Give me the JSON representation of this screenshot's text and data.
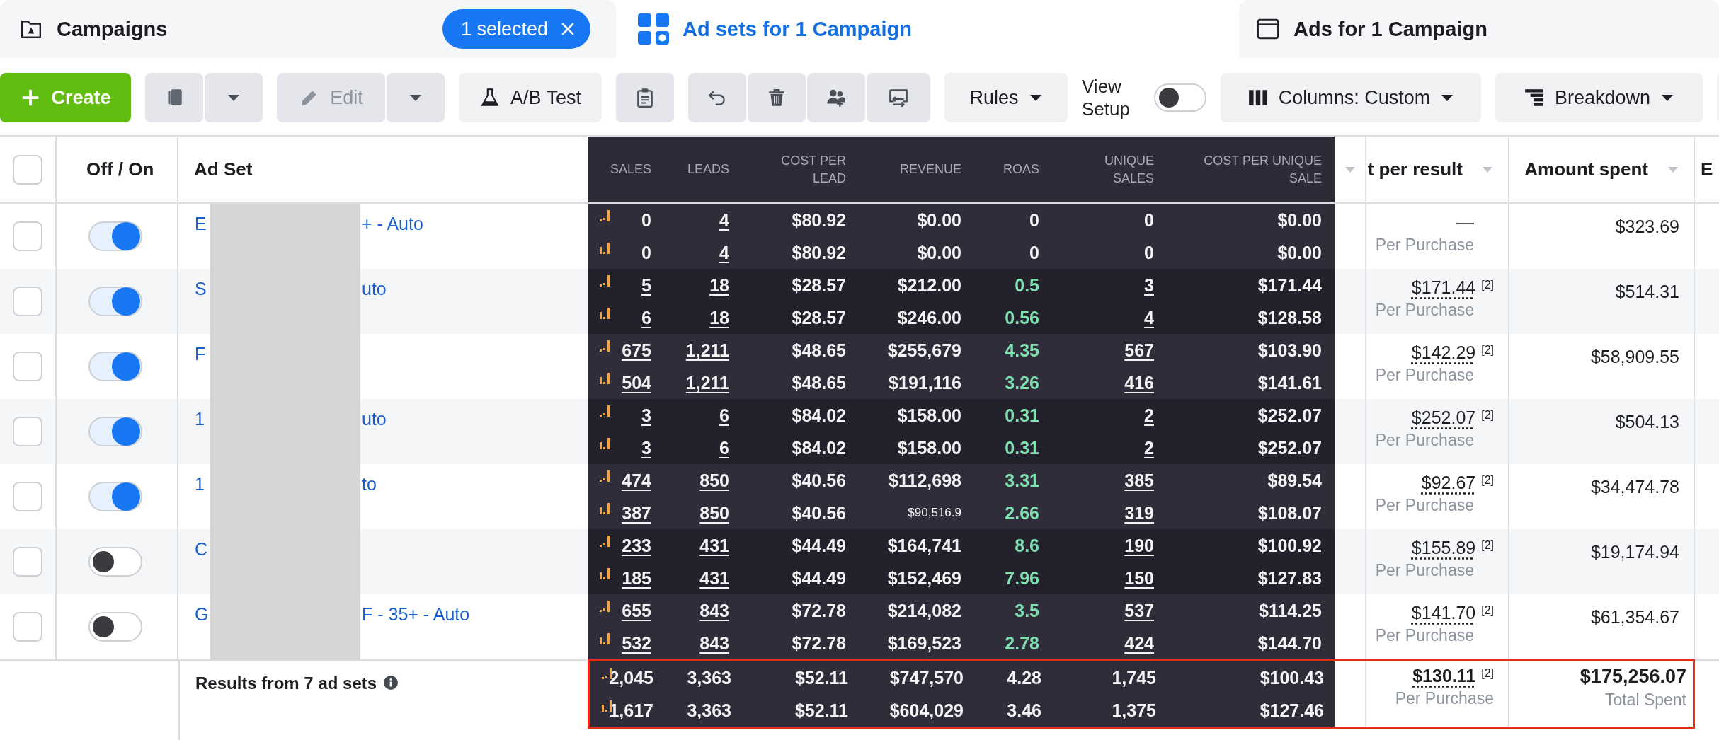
{
  "tabs": [
    {
      "kind": "campaigns",
      "label": "Campaigns",
      "selected": false,
      "badge": "1 selected"
    },
    {
      "kind": "adsets",
      "label": "Ad sets for 1 Campaign",
      "selected": true
    },
    {
      "kind": "ads",
      "label": "Ads for 1 Campaign",
      "selected": false
    }
  ],
  "toolbar": [
    {
      "kind": "group",
      "buttons": [
        {
          "kind": "create",
          "label": "Create"
        }
      ]
    },
    {
      "kind": "group",
      "buttons": [
        {
          "kind": "duplicate"
        },
        {
          "kind": "dropdown"
        }
      ]
    },
    {
      "kind": "group",
      "buttons": [
        {
          "kind": "edit",
          "label": "Edit",
          "disabled": true
        },
        {
          "kind": "dropdown"
        }
      ]
    },
    {
      "kind": "group",
      "buttons": [
        {
          "kind": "test",
          "label": "A/B Test"
        }
      ]
    },
    {
      "kind": "group",
      "buttons": [
        {
          "kind": "paste"
        }
      ]
    },
    {
      "kind": "group",
      "buttons": [
        {
          "kind": "undo"
        },
        {
          "kind": "delete"
        },
        {
          "kind": "share"
        },
        {
          "kind": "swap"
        }
      ]
    },
    {
      "kind": "group",
      "buttons": [
        {
          "kind": "rules",
          "label": "Rules"
        }
      ]
    },
    {
      "kind": "switch",
      "label": "View Setup",
      "on": false
    },
    {
      "kind": "group",
      "buttons": [
        {
          "kind": "columns",
          "label": "Columns: Custom"
        }
      ]
    },
    {
      "kind": "group",
      "buttons": [
        {
          "kind": "breakdown",
          "label": "Breakdown"
        }
      ]
    },
    {
      "kind": "group",
      "buttons": [
        {
          "kind": "blank"
        }
      ]
    }
  ],
  "table": {
    "header_checked": false,
    "columns": [
      "Off / On",
      "Ad Set"
    ],
    "metric_columns": [
      "SALES",
      "LEADS",
      "COST PER LEAD",
      "REVENUE",
      "ROAS",
      "UNIQUE SALES",
      "COST PER UNIQUE SALE"
    ],
    "right_columns": [
      "t per result",
      "Amount spent",
      "E"
    ],
    "rows": [
      {
        "checked": false,
        "on": true,
        "name_start": "E",
        "name_end": "+ - Auto",
        "lines": [
          [
            {
              "text": "0"
            },
            {
              "text": "4",
              "link": true
            },
            {
              "text": "$80.92"
            },
            {
              "text": "$0.00"
            },
            {
              "text": "0",
              "positive": false
            },
            {
              "text": "0"
            },
            {
              "text": "$0.00"
            }
          ],
          [
            {
              "text": "0"
            },
            {
              "text": "4",
              "link": true
            },
            {
              "text": "$80.92"
            },
            {
              "text": "$0.00"
            },
            {
              "text": "0",
              "positive": false
            },
            {
              "text": "0"
            },
            {
              "text": "$0.00"
            }
          ]
        ],
        "cost_per_result": "—",
        "result_label": "Per Purchase",
        "amount_spent": "$323.69"
      },
      {
        "checked": false,
        "on": true,
        "name_start": "S",
        "name_end": "uto",
        "lines": [
          [
            {
              "text": "5",
              "link": true
            },
            {
              "text": "18",
              "link": true
            },
            {
              "text": "$28.57"
            },
            {
              "text": "$212.00"
            },
            {
              "text": "0.5",
              "positive": true
            },
            {
              "text": "3",
              "link": true
            },
            {
              "text": "$171.44"
            }
          ],
          [
            {
              "text": "6",
              "link": true
            },
            {
              "text": "18",
              "link": true
            },
            {
              "text": "$28.57"
            },
            {
              "text": "$246.00"
            },
            {
              "text": "0.56",
              "positive": true
            },
            {
              "text": "4",
              "link": true
            },
            {
              "text": "$128.58"
            }
          ]
        ],
        "cost_per_result": "$171.44",
        "footnote": "[2]",
        "result_label": "Per Purchase",
        "amount_spent": "$514.31"
      },
      {
        "checked": false,
        "on": true,
        "name_start": "F",
        "lines": [
          [
            {
              "text": "675",
              "link": true
            },
            {
              "text": "1,211",
              "link": true
            },
            {
              "text": "$48.65"
            },
            {
              "text": "$255,679"
            },
            {
              "text": "4.35",
              "positive": true
            },
            {
              "text": "567",
              "link": true
            },
            {
              "text": "$103.90"
            }
          ],
          [
            {
              "text": "504",
              "link": true
            },
            {
              "text": "1,211",
              "link": true
            },
            {
              "text": "$48.65"
            },
            {
              "text": "$191,116"
            },
            {
              "text": "3.26",
              "positive": true
            },
            {
              "text": "416",
              "link": true
            },
            {
              "text": "$141.61"
            }
          ]
        ],
        "cost_per_result": "$142.29",
        "footnote": "[2]",
        "result_label": "Per Purchase",
        "amount_spent": "$58,909.55"
      },
      {
        "checked": false,
        "on": true,
        "name_start": "1",
        "name_end": "uto",
        "lines": [
          [
            {
              "text": "3",
              "link": true
            },
            {
              "text": "6",
              "link": true
            },
            {
              "text": "$84.02"
            },
            {
              "text": "$158.00"
            },
            {
              "text": "0.31",
              "positive": true
            },
            {
              "text": "2",
              "link": true
            },
            {
              "text": "$252.07"
            }
          ],
          [
            {
              "text": "3",
              "link": true
            },
            {
              "text": "6",
              "link": true
            },
            {
              "text": "$84.02"
            },
            {
              "text": "$158.00"
            },
            {
              "text": "0.31",
              "positive": true
            },
            {
              "text": "2",
              "link": true
            },
            {
              "text": "$252.07"
            }
          ]
        ],
        "cost_per_result": "$252.07",
        "footnote": "[2]",
        "result_label": "Per Purchase",
        "amount_spent": "$504.13"
      },
      {
        "checked": false,
        "on": true,
        "name_start": "1",
        "name_end": "to",
        "lines": [
          [
            {
              "text": "474",
              "link": true
            },
            {
              "text": "850",
              "link": true
            },
            {
              "text": "$40.56"
            },
            {
              "text": "$112,698"
            },
            {
              "text": "3.31",
              "positive": true
            },
            {
              "text": "385",
              "link": true
            },
            {
              "text": "$89.54"
            }
          ],
          [
            {
              "text": "387",
              "link": true
            },
            {
              "text": "850",
              "link": true
            },
            {
              "text": "$40.56"
            },
            {
              "text": "$90,516.9",
              "small": true
            },
            {
              "text": "2.66",
              "positive": true
            },
            {
              "text": "319",
              "link": true
            },
            {
              "text": "$108.07"
            }
          ]
        ],
        "cost_per_result": "$92.67",
        "footnote": "[2]",
        "result_label": "Per Purchase",
        "amount_spent": "$34,474.78"
      },
      {
        "checked": false,
        "on": false,
        "name_start": "C",
        "lines": [
          [
            {
              "text": "233",
              "link": true
            },
            {
              "text": "431",
              "link": true
            },
            {
              "text": "$44.49"
            },
            {
              "text": "$164,741"
            },
            {
              "text": "8.6",
              "positive": true
            },
            {
              "text": "190",
              "link": true
            },
            {
              "text": "$100.92"
            }
          ],
          [
            {
              "text": "185",
              "link": true
            },
            {
              "text": "431",
              "link": true
            },
            {
              "text": "$44.49"
            },
            {
              "text": "$152,469"
            },
            {
              "text": "7.96",
              "positive": true
            },
            {
              "text": "150",
              "link": true
            },
            {
              "text": "$127.83"
            }
          ]
        ],
        "cost_per_result": "$155.89",
        "footnote": "[2]",
        "result_label": "Per Purchase",
        "amount_spent": "$19,174.94"
      },
      {
        "checked": false,
        "on": false,
        "name_start": "G",
        "name_end": "F - 35+ - Auto",
        "lines": [
          [
            {
              "text": "655",
              "link": true
            },
            {
              "text": "843",
              "link": true
            },
            {
              "text": "$72.78"
            },
            {
              "text": "$214,082"
            },
            {
              "text": "3.5",
              "positive": true
            },
            {
              "text": "537",
              "link": true
            },
            {
              "text": "$114.25"
            }
          ],
          [
            {
              "text": "532",
              "link": true
            },
            {
              "text": "843",
              "link": true
            },
            {
              "text": "$72.78"
            },
            {
              "text": "$169,523"
            },
            {
              "text": "2.78",
              "positive": true
            },
            {
              "text": "424",
              "link": true
            },
            {
              "text": "$144.70"
            }
          ]
        ],
        "cost_per_result": "$141.70",
        "footnote": "[2]",
        "result_label": "Per Purchase",
        "amount_spent": "$61,354.67"
      }
    ],
    "totals": {
      "label": "Results from 7 ad sets",
      "highlighted": true,
      "lines": [
        [
          {
            "text": "2,045"
          },
          {
            "text": "3,363"
          },
          {
            "text": "$52.11"
          },
          {
            "text": "$747,570"
          },
          {
            "text": "4.28",
            "positive": false
          },
          {
            "text": "1,745"
          },
          {
            "text": "$100.43"
          }
        ],
        [
          {
            "text": "1,617"
          },
          {
            "text": "3,363"
          },
          {
            "text": "$52.11"
          },
          {
            "text": "$604,029"
          },
          {
            "text": "3.46",
            "positive": false
          },
          {
            "text": "1,375"
          },
          {
            "text": "$127.46"
          }
        ]
      ],
      "cost_per_result": "$130.11",
      "footnote": "[2]",
      "result_label": "Per Purchase",
      "amount_spent": "$175,256.07",
      "amount_label": "Total Spent"
    }
  }
}
